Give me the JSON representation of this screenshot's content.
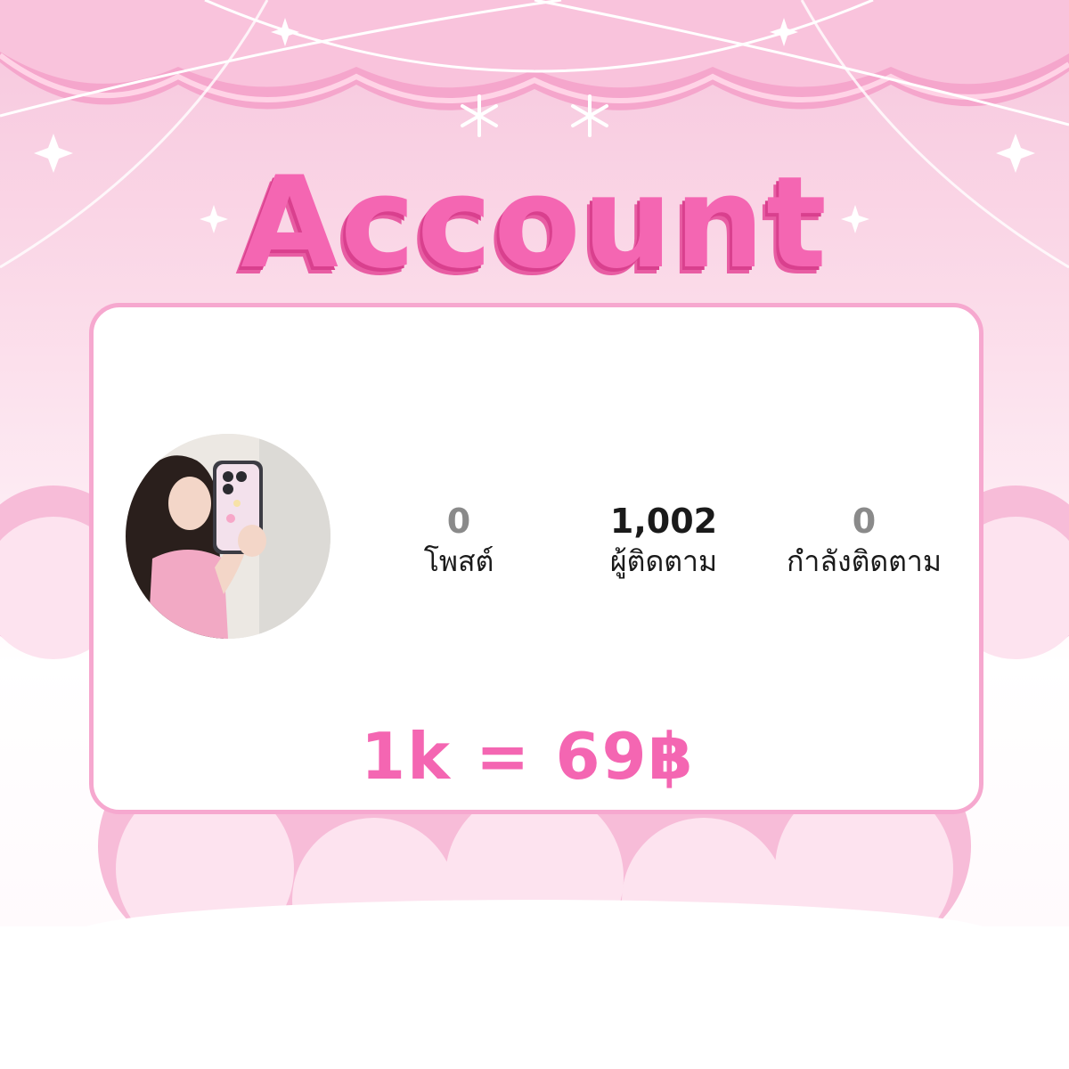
{
  "title": "Account",
  "profile": {
    "stats": [
      {
        "value": "0",
        "label": "โพสต์"
      },
      {
        "value": "1,002",
        "label": "ผู้ติดตาม"
      },
      {
        "value": "0",
        "label": "กำลังติดตาม"
      }
    ]
  },
  "price": "1k = 69฿",
  "colors": {
    "accent": "#f466b2",
    "card_border": "#f6a8cf",
    "background_top": "#f7c6dd"
  }
}
